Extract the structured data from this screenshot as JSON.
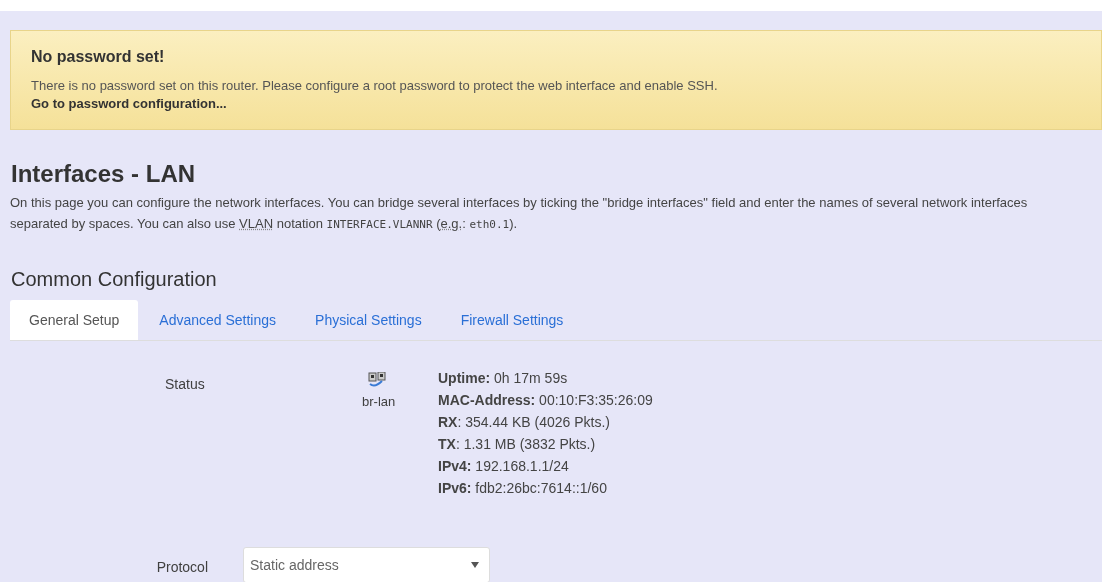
{
  "alert": {
    "title": "No password set!",
    "message": "There is no password set on this router. Please configure a root password to protect the web interface and enable SSH.",
    "link": "Go to password configuration..."
  },
  "page": {
    "title": "Interfaces - LAN",
    "description": [
      {
        "kind": "text",
        "text": "On this page you can configure the network interfaces. You can bridge several interfaces by ticking the \"bridge interfaces\" field and enter the names of several network interfaces separated by spaces. You can also use "
      },
      {
        "kind": "abbr",
        "text": "VLAN"
      },
      {
        "kind": "text",
        "text": " notation "
      },
      {
        "kind": "code",
        "text": "INTERFACE.VLANNR"
      },
      {
        "kind": "text",
        "text": " ("
      },
      {
        "kind": "abbr",
        "text": "e.g."
      },
      {
        "kind": "text",
        "text": ": "
      },
      {
        "kind": "code",
        "text": "eth0.1"
      },
      {
        "kind": "text",
        "text": ")."
      }
    ]
  },
  "section": {
    "title": "Common Configuration"
  },
  "tabs": [
    {
      "label": "General Setup",
      "selected": true
    },
    {
      "label": "Advanced Settings",
      "selected": false
    },
    {
      "label": "Physical Settings",
      "selected": false
    },
    {
      "label": "Firewall Settings",
      "selected": false
    }
  ],
  "status": {
    "label": "Status",
    "device": "br-lan",
    "lines": [
      "**Uptime:** 0h 17m 59s",
      "**MAC-Address:** 00:10:F3:35:26:09",
      "**RX**: 354.44 KB (4026 Pkts.)",
      "**TX**: 1.31 MB (3832 Pkts.)",
      "**IPv4:** 192.168.1.1/24",
      "**IPv6:** fdb2:26bc:7614::1/60"
    ]
  },
  "protocol": {
    "label": "Protocol",
    "value": "Static address"
  }
}
